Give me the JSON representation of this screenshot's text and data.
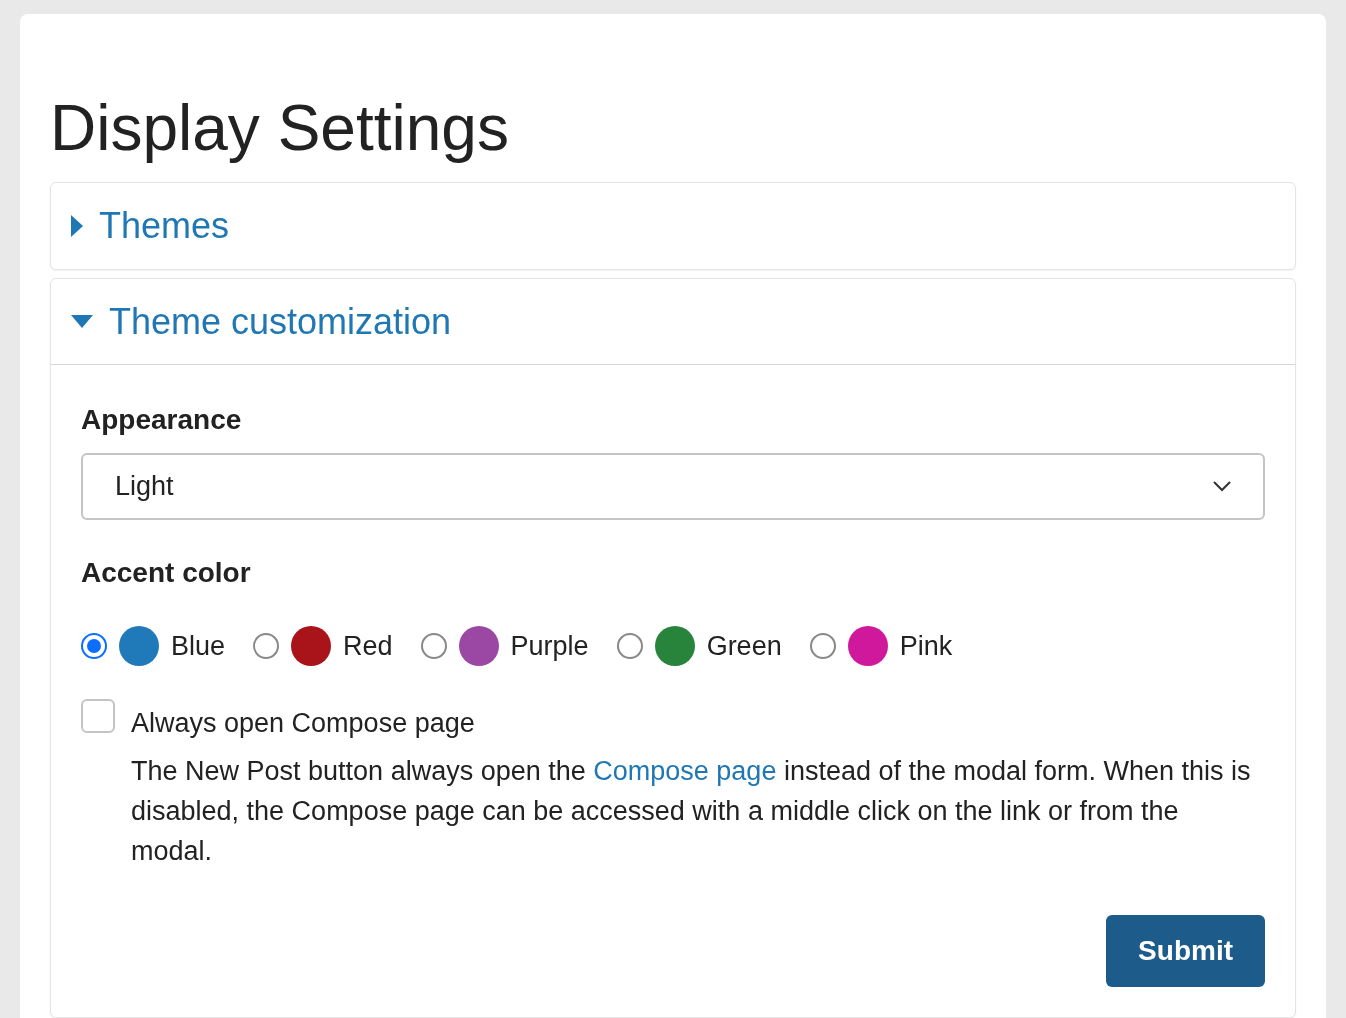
{
  "page": {
    "title": "Display Settings"
  },
  "sections": [
    {
      "title": "Themes",
      "expanded": false
    },
    {
      "title": "Theme customization",
      "expanded": true,
      "content": {
        "appearance": {
          "label": "Appearance",
          "value": "Light"
        },
        "accent": {
          "label": "Accent color",
          "options": [
            {
              "label": "Blue",
              "color": "#2079b8",
              "selected": true
            },
            {
              "label": "Red",
              "color": "#a8141a",
              "selected": false
            },
            {
              "label": "Purple",
              "color": "#9b48a4",
              "selected": false
            },
            {
              "label": "Green",
              "color": "#27843a",
              "selected": false
            },
            {
              "label": "Pink",
              "color": "#d0189c",
              "selected": false
            }
          ]
        },
        "compose": {
          "label": "Always open Compose page",
          "checked": false,
          "before": "The New Post button always open the ",
          "link": "Compose page",
          "after": " instead of the modal form. When this is disabled, the Compose page can be accessed with a middle click on the link or from the modal."
        },
        "submit": "Submit"
      }
    }
  ]
}
